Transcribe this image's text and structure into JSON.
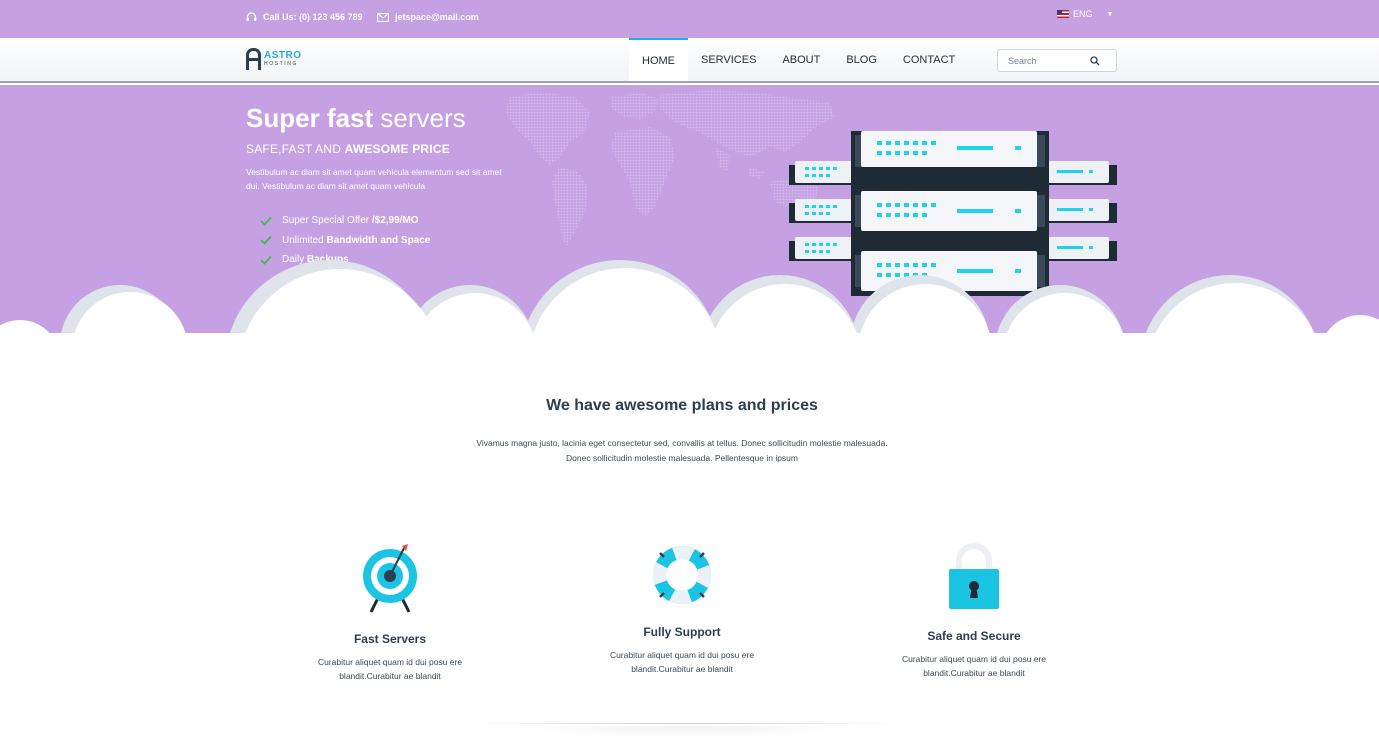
{
  "topbar": {
    "phone": "Call Us: (0) 123 456 789",
    "email": "jetspace@mail.com",
    "language": "ENG"
  },
  "logo": {
    "word1": "ASTRO",
    "word2": "HOSTING"
  },
  "nav": {
    "items": [
      {
        "label": "HOME",
        "active": true
      },
      {
        "label": "SERVICES"
      },
      {
        "label": "ABOUT"
      },
      {
        "label": "BLOG"
      },
      {
        "label": "CONTACT"
      }
    ],
    "search_placeholder": "Search"
  },
  "hero": {
    "title_bold": "Super fast",
    "title_light": "servers",
    "subtitle_light": "SAFE,FAST AND",
    "subtitle_bold": "AWESOME PRICE",
    "description": "Vestibulum ac diam sit amet quam vehicula elementum sed sit amet dui. Vestibulum ac diam sit amet quam vehicula",
    "features": [
      {
        "text": "Super Special Offer",
        "bold": "/$2,99/MO"
      },
      {
        "text": "Unlimited",
        "bold": "Bandwidth and Space"
      },
      {
        "text": "Daily",
        "bold": "Backups"
      }
    ]
  },
  "plans": {
    "title": "We have awesome plans and prices",
    "description": "Vivamus magna justo, lacinia eget consectetur sed, convallis at tellus. Donec sollicitudin molestie malesuada. Donec sollicitudin molestie malesuada. Pellentesque in ipsum"
  },
  "features": [
    {
      "icon": "target-icon",
      "title": "Fast Servers",
      "text": "Curabitur aliquet quam id dui posu ere blandit.Curabitur ae blandit"
    },
    {
      "icon": "lifebuoy-icon",
      "title": "Fully Support",
      "text": "Curabitur aliquet quam id dui posu ere blandit.Curabitur ae blandit"
    },
    {
      "icon": "padlock-icon",
      "title": "Safe and Secure",
      "text": "Curabitur aliquet quam id dui posu ere blandit.Curabitur ae blandit"
    }
  ],
  "colors": {
    "brand_purple": "#c5a0e3",
    "accent_blue": "#27a9e1",
    "server_cyan": "#1fd3ef",
    "check_green": "#3fb950",
    "dark_text": "#2c3e50"
  }
}
